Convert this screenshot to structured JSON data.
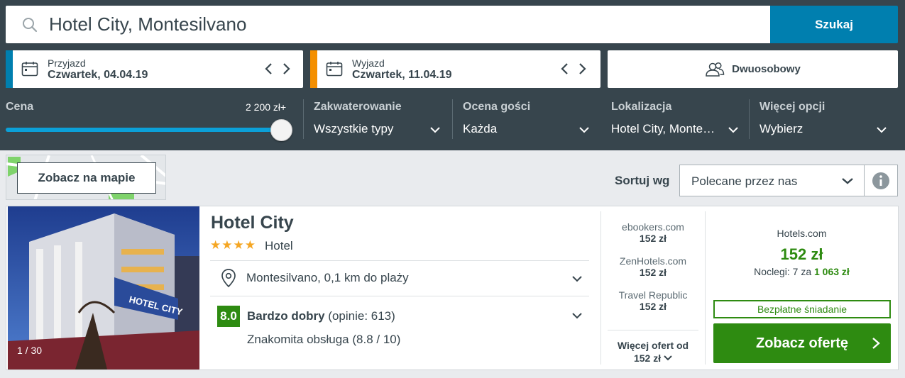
{
  "search": {
    "query": "Hotel City, Montesilvano",
    "button_label": "Szukaj"
  },
  "dates": {
    "checkin": {
      "label": "Przyjazd",
      "value": "Czwartek, 04.04.19",
      "accent": "#007faf"
    },
    "checkout": {
      "label": "Wyjazd",
      "value": "Czwartek, 11.04.19",
      "accent": "#f48f00"
    }
  },
  "room": {
    "label": "Dwuosobowy",
    "icon": "people-icon"
  },
  "filters": {
    "price": {
      "label": "Cena",
      "max_label": "2 200 zł+",
      "slider_fraction": 1.0
    },
    "accommodation": {
      "label": "Zakwaterowanie",
      "value": "Wszystkie typy"
    },
    "rating": {
      "label": "Ocena gości",
      "value": "Każda"
    },
    "location": {
      "label": "Lokalizacja",
      "value": "Hotel City, Monte…"
    },
    "more": {
      "label": "Więcej opcji",
      "value": "Wybierz"
    }
  },
  "map": {
    "button_label": "Zobacz na mapie"
  },
  "sort": {
    "label": "Sortuj wg",
    "value": "Polecane przez nas"
  },
  "hotel": {
    "name": "Hotel City",
    "stars": "★★★★",
    "star_count": 4,
    "type": "Hotel",
    "photo_counter": "1 / 30",
    "location": "Montesilvano, 0,1 km do plaży",
    "rating_score": "8.0",
    "rating_word": "Bardzo dobry",
    "rating_reviews": "(opinie: 613)",
    "service": "Znakomita obsługa (8.8 / 10)"
  },
  "offers": [
    {
      "site": "ebookers.com",
      "price": "152 zł"
    },
    {
      "site": "ZenHotels.com",
      "price": "152 zł"
    },
    {
      "site": "Travel Republic",
      "price": "152 zł"
    }
  ],
  "more_offers": {
    "label": "Więcej ofert od",
    "price": "152 zł"
  },
  "best_offer": {
    "site": "Hotels.com",
    "price": "152 zł",
    "nights_prefix": "Noclegi: 7 za",
    "nights_total": "1 063 zł",
    "badge": "Bezpłatne śniadanie",
    "cta": "Zobacz ofertę"
  },
  "colors": {
    "header_bg": "#37454d",
    "search_button": "#007faf",
    "slider": "#0ba0d8",
    "deal_green": "#2e8b11",
    "checkout_accent": "#f48f00"
  }
}
